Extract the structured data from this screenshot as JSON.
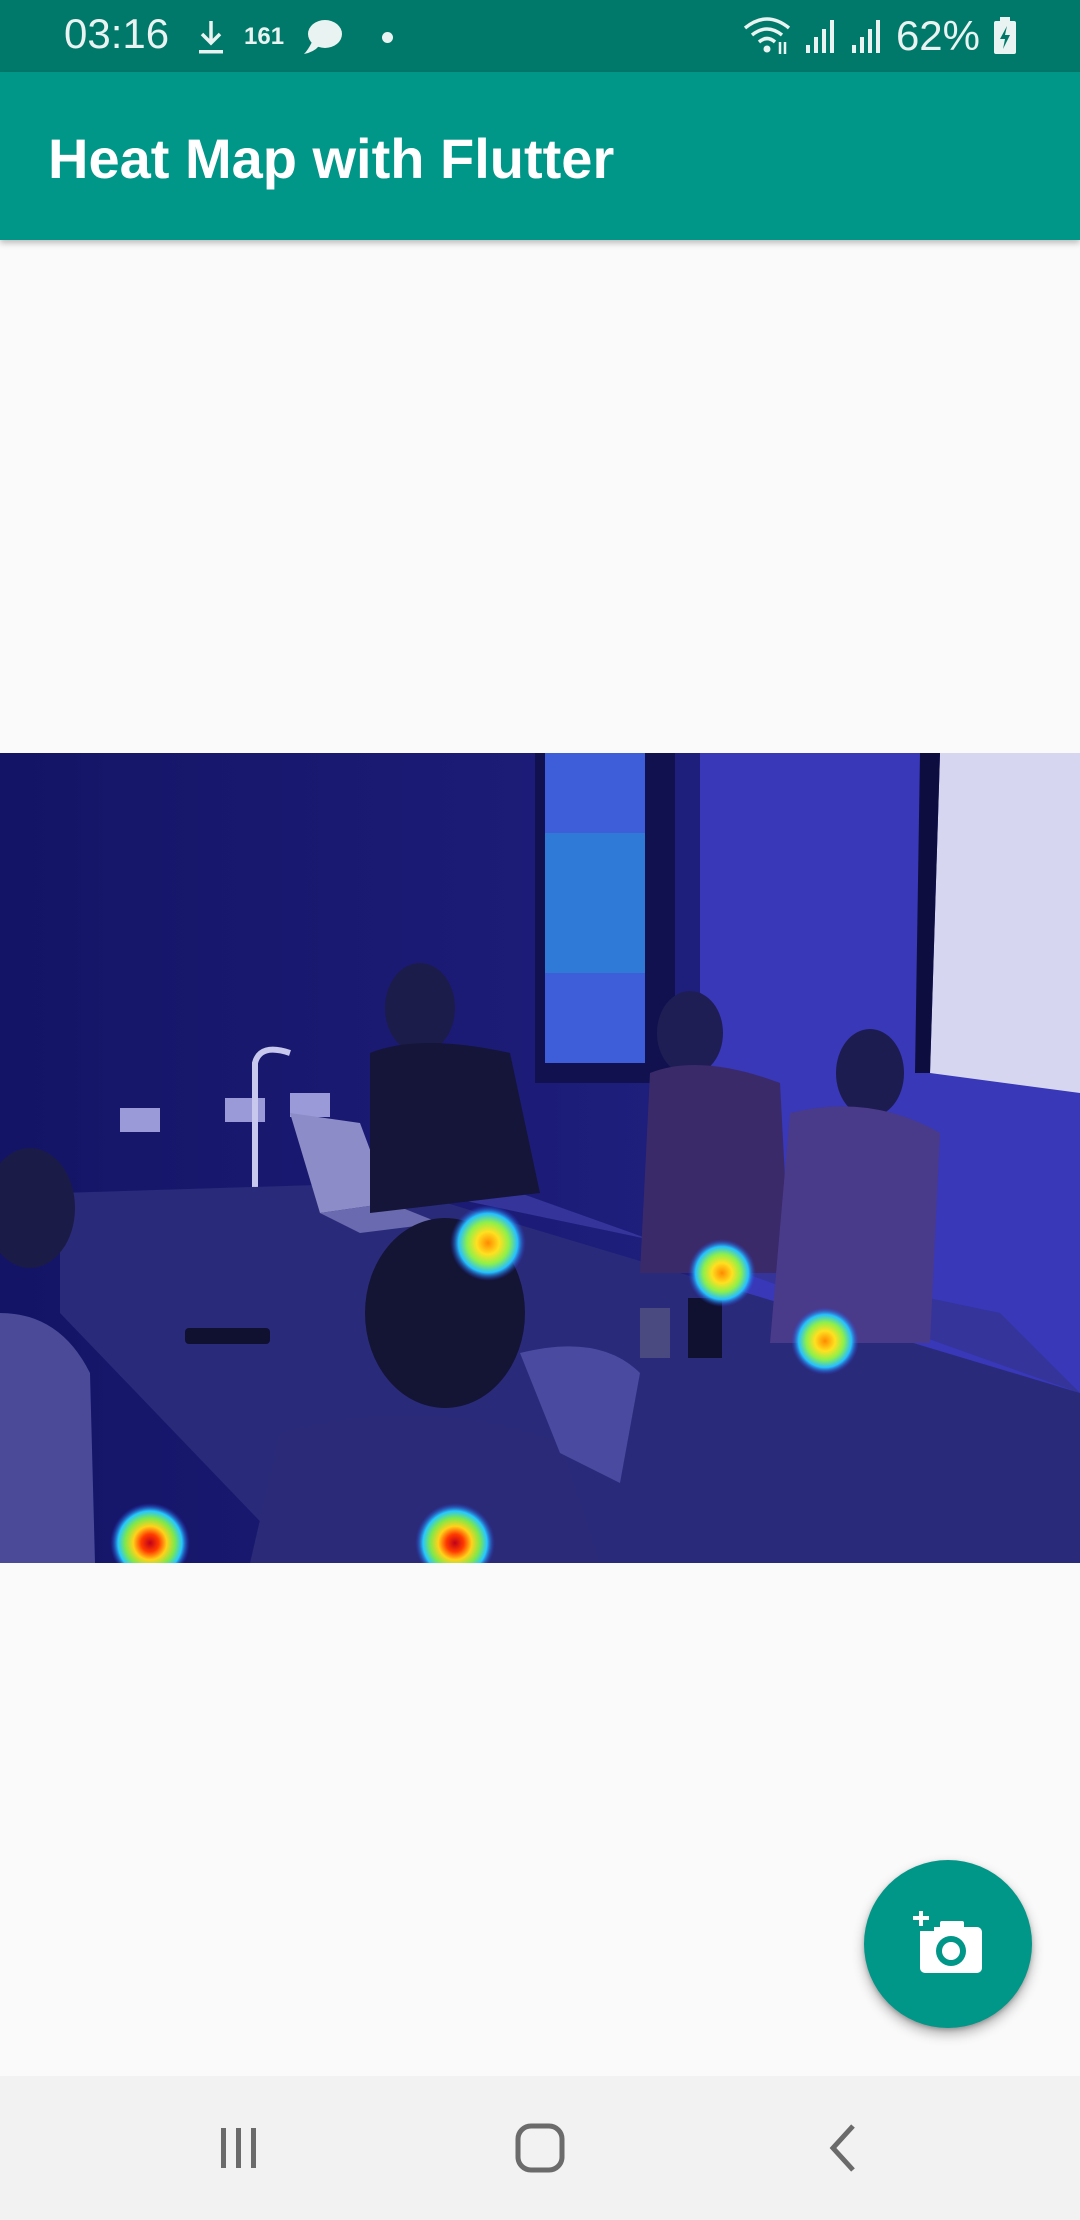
{
  "status_bar": {
    "time": "03:16",
    "notification_count": "161",
    "battery": "62%",
    "icons": [
      "download-icon",
      "chat-bubble-icon",
      "dot-icon",
      "wifi-icon",
      "signal-icon",
      "signal-icon",
      "battery-charging-icon"
    ]
  },
  "app_bar": {
    "title": "Heat Map with Flutter"
  },
  "fab": {
    "icon": "add-a-photo-icon"
  },
  "nav_bar": {
    "buttons": [
      "recent-apps-icon",
      "home-icon",
      "back-icon"
    ]
  },
  "colors": {
    "status_bar": "#00796b",
    "app_bar": "#009688",
    "background": "#fafafa",
    "nav_bar": "#f2f2f2"
  }
}
